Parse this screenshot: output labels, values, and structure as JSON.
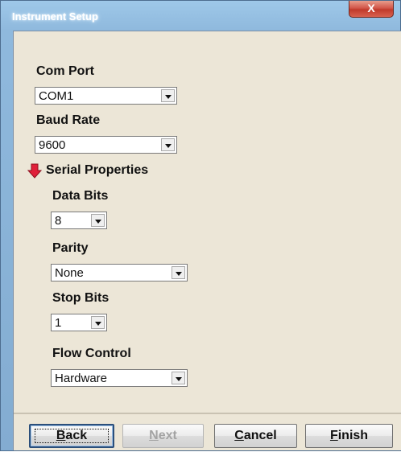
{
  "window": {
    "title": "Instrument Setup",
    "close_label": "X"
  },
  "com_port": {
    "label": "Com Port",
    "value": "COM1"
  },
  "baud_rate": {
    "label": "Baud Rate",
    "value": "9600"
  },
  "serial_properties": {
    "label": "Serial Properties",
    "icon": "red-down-arrow-icon",
    "expanded": true,
    "data_bits": {
      "label": "Data Bits",
      "value": "8"
    },
    "parity": {
      "label": "Parity",
      "value": "None"
    },
    "stop_bits": {
      "label": "Stop Bits",
      "value": "1"
    },
    "flow_control": {
      "label": "Flow Control",
      "value": "Hardware"
    }
  },
  "buttons": {
    "back": {
      "prefix": "",
      "accel": "B",
      "rest": "ack"
    },
    "next": {
      "prefix": "",
      "accel": "N",
      "rest": "ext",
      "enabled": false
    },
    "cancel": {
      "prefix": "",
      "accel": "C",
      "rest": "ancel"
    },
    "finish": {
      "prefix": "",
      "accel": "F",
      "rest": "inish"
    }
  },
  "colors": {
    "arrow": "#e0203a",
    "client_background": "#ece6d7",
    "title_gradient": "#8fb9dd"
  }
}
